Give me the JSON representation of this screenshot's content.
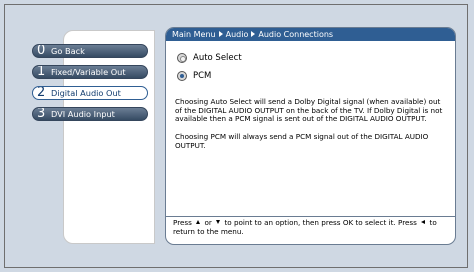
{
  "breadcrumb": {
    "items": [
      "Main Menu",
      "Audio",
      "Audio Connections"
    ]
  },
  "menu": {
    "items": [
      {
        "num": "0",
        "label": "Go Back"
      },
      {
        "num": "1",
        "label": "Fixed/Variable Out"
      },
      {
        "num": "2",
        "label": "Digital Audio Out"
      },
      {
        "num": "3",
        "label": "DVI Audio Input"
      }
    ],
    "selected_index": 2
  },
  "options": {
    "items": [
      {
        "label": "Auto Select",
        "selected": false
      },
      {
        "label": "PCM",
        "selected": true
      }
    ]
  },
  "description": {
    "paragraphs": [
      "Choosing Auto Select will send a Dolby Digital signal (when available) out of the DIGITAL AUDIO OUTPUT on the back of the TV. If Dolby Digital is not available then a PCM signal is sent out of the DIGITAL AUDIO OUTPUT.",
      "Choosing PCM will always send a PCM signal out of the DIGITAL AUDIO OUTPUT."
    ]
  },
  "footer": {
    "part1": "Press",
    "part2": "or",
    "part3": "to point to an option, then press OK to select it. Press",
    "part4": "to return to the menu."
  },
  "colors": {
    "header_blue": "#2f5e93",
    "background": "#cfd8e3",
    "menu_button_dark": "#364b63"
  }
}
